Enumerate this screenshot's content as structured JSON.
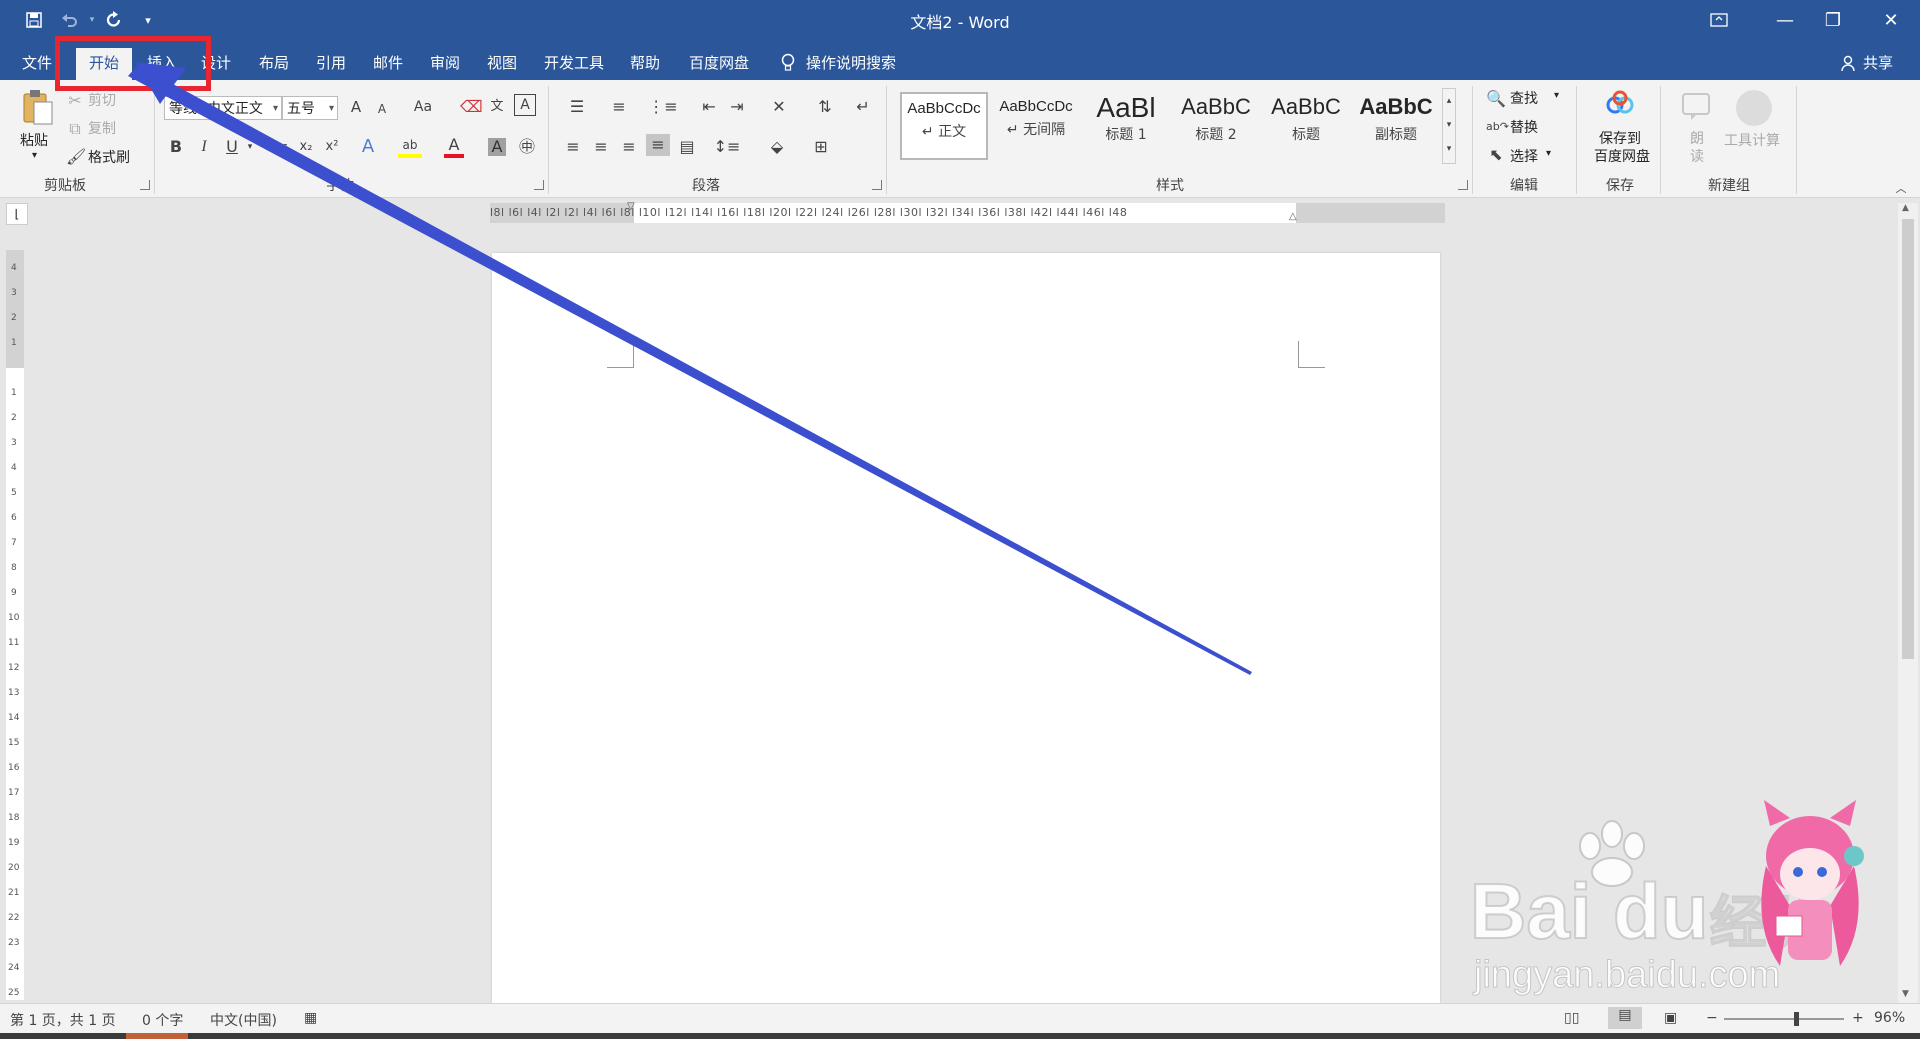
{
  "window": {
    "title": "文档2 - Word",
    "quick_access": {
      "save_icon": "save-icon",
      "undo_icon": "undo-icon",
      "redo_icon": "repeat-icon",
      "customize_icon": "customize-icon"
    },
    "controls": {
      "ribbon_display_icon": "ribbon-display-icon",
      "minimize": "—",
      "restore": "❐",
      "close": "✕"
    }
  },
  "tabs": [
    "文件",
    "开始",
    "插入",
    "设计",
    "布局",
    "引用",
    "邮件",
    "审阅",
    "视图",
    "开发工具",
    "帮助",
    "百度网盘"
  ],
  "active_tab": "开始",
  "tell_me": "操作说明搜索",
  "share": "共享",
  "ribbon": {
    "clipboard": {
      "paste": "粘贴",
      "cut": "剪切",
      "copy": "复制",
      "format_painter": "格式刷",
      "label": "剪贴板"
    },
    "font": {
      "font_name": "等线 (中文正文",
      "font_size": "五号",
      "bold": "B",
      "italic": "I",
      "underline": "U",
      "strike": "abc",
      "subscript": "x₂",
      "superscript": "x²",
      "grow": "A",
      "shrink": "A",
      "change_case": "Aa",
      "highlight": "ab",
      "font_color": "A",
      "char_shading": "A",
      "label": "字体"
    },
    "paragraph": {
      "label": "段落"
    },
    "styles": {
      "items": [
        {
          "sample": "AaBbCcDc",
          "name": "↵ 正文"
        },
        {
          "sample": "AaBbCcDc",
          "name": "↵ 无间隔"
        },
        {
          "sample": "AaBl",
          "name": "标题 1"
        },
        {
          "sample": "AaBbC",
          "name": "标题 2"
        },
        {
          "sample": "AaBbC",
          "name": "标题"
        },
        {
          "sample": "AaBbC",
          "name": "副标题"
        }
      ],
      "label": "样式"
    },
    "editing": {
      "find": "查找",
      "replace": "替换",
      "select": "选择",
      "label": "编辑"
    },
    "save": {
      "button": "保存到\n百度网盘",
      "line1": "保存到",
      "line2": "百度网盘",
      "label": "保存"
    },
    "newgroup": {
      "read": "朗读",
      "read1": "朗",
      "read2": "读",
      "tools": "工具计算",
      "label": "新建组"
    }
  },
  "ruler": {
    "ticks": "l8l  l6l  l4l  l2l       l2l  l4l  l6l  l8l  l10l l12l l14l l16l l18l l20l l22l l24l l26l l28l l30l l32l l34l l36l l38l      l42l l44l l46l l48"
  },
  "status": {
    "page": "第 1 页，共 1 页",
    "words": "0 个字",
    "language": "中文(中国)",
    "zoom": "96%",
    "zoom_level": 0.6
  },
  "watermark": {
    "brand": "Bai du",
    "sub": "jingyan.baidu.com",
    "cn": "经验"
  },
  "colors": {
    "title_bar": "#2b579a",
    "highlight_box": "#e8262f",
    "arrow": "#3b4fcf"
  }
}
